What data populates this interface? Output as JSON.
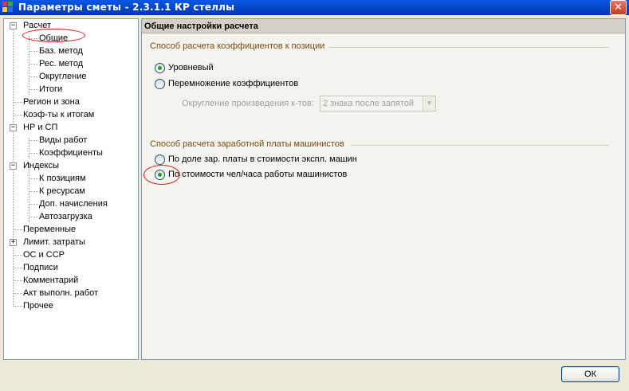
{
  "window": {
    "title": "Параметры сметы - 2.3.1.1 КР стеллы",
    "close_glyph": "✕"
  },
  "tree": {
    "items": [
      {
        "label": "Расчет",
        "expander": "−"
      },
      {
        "label": "Общие"
      },
      {
        "label": "Баз. метод"
      },
      {
        "label": "Рес. метод"
      },
      {
        "label": "Округление"
      },
      {
        "label": "Итоги"
      },
      {
        "label": "Регион и зона"
      },
      {
        "label": "Коэф-ты к итогам"
      },
      {
        "label": "НР и СП",
        "expander": "−"
      },
      {
        "label": "Виды работ"
      },
      {
        "label": "Коэффициенты"
      },
      {
        "label": "Индексы",
        "expander": "−"
      },
      {
        "label": "К позициям"
      },
      {
        "label": "К ресурсам"
      },
      {
        "label": "Доп. начисления"
      },
      {
        "label": "Автозагрузка"
      },
      {
        "label": "Переменные"
      },
      {
        "label": "Лимит. затраты",
        "expander": "+"
      },
      {
        "label": "ОС и ССР"
      },
      {
        "label": "Подписи"
      },
      {
        "label": "Комментарий"
      },
      {
        "label": "Акт выполн. работ"
      },
      {
        "label": "Прочее"
      }
    ]
  },
  "panel": {
    "header": "Общие настройки расчета",
    "group1": {
      "title": "Способ расчета коэффициентов к позиции",
      "options": [
        "Уровневый",
        "Перемножение коэффициентов"
      ],
      "selected": 0,
      "rounding_label": "Округление произведения к-тов:",
      "rounding_value": "2 знака после запятой"
    },
    "group2": {
      "title": "Способ расчета заработной платы машинистов",
      "options": [
        "По доле зар. платы в стоимости экспл. машин",
        "По стоимости чел/часа работы машинистов"
      ],
      "selected": 1
    }
  },
  "buttons": {
    "ok": "ОК"
  },
  "colors": {
    "title_bar": "#0346C8",
    "annotation": "#D81818",
    "radio_dot": "#21A121",
    "group_title": "#7A4A12"
  }
}
